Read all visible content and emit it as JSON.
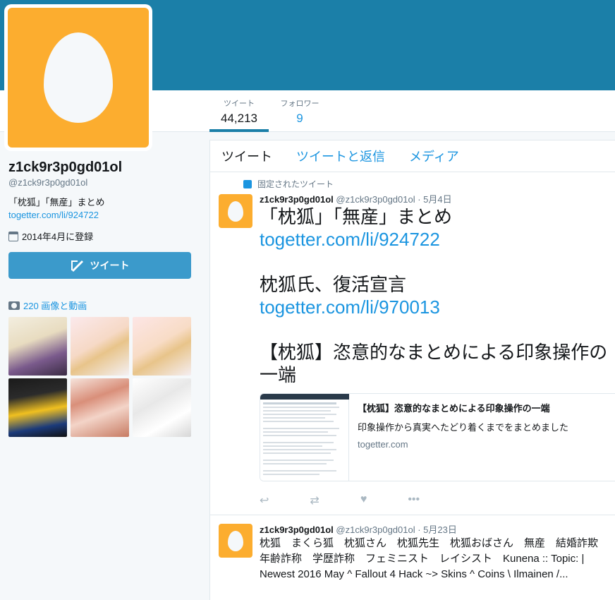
{
  "profile": {
    "name": "z1ck9r3p0gd01ol",
    "handle": "@z1ck9r3p0gd01ol",
    "bio": "「枕狐」「無産」まとめ",
    "bio_link": "togetter.com/li/924722",
    "joined": "2014年4月に登録",
    "tweet_button": "ツイート",
    "media_link": "220 画像と動画"
  },
  "stats": {
    "tweets_label": "ツイート",
    "tweets_value": "44,213",
    "followers_label": "フォロワー",
    "followers_value": "9"
  },
  "tabs": [
    "ツイート",
    "ツイートと返信",
    "メディア"
  ],
  "pinned_label": "固定されたツイート",
  "tweet1": {
    "name": "z1ck9r3p0gd01ol",
    "meta": "@z1ck9r3p0gd01ol · 5月4日",
    "line1": "「枕狐」「無産」まとめ",
    "link1": "togetter.com/li/924722",
    "line2": "枕狐氏、復活宣言",
    "link2": "togetter.com/li/970013",
    "line3": "【枕狐】恣意的なまとめによる印象操作の一端",
    "card_title": "【枕狐】恣意的なまとめによる印象操作の一端",
    "card_desc": "印象操作から真実へたどり着くまでをまとめました",
    "card_domain": "togetter.com"
  },
  "tweet2": {
    "name": "z1ck9r3p0gd01ol",
    "meta": "@z1ck9r3p0gd01ol · 5月23日",
    "text": "枕狐　まくら狐　枕狐さん　枕狐先生　枕狐おばさん　無産　結婚詐欺　年齢詐称　学歴詐称　フェミニスト　レイシスト　Kunena :: Topic: | Newest 2016 May ^ Fallout 4 Hack ~> Skins ^ Coins \\ Ilmainen /..."
  },
  "icons": {
    "reply": "↩",
    "retweet": "⇄",
    "like": "♥",
    "more": "•••"
  },
  "colors": {
    "banner": "#1b7fa8",
    "avatar": "#fcad2f",
    "link": "#1b95e0",
    "button": "#3b9acb"
  }
}
